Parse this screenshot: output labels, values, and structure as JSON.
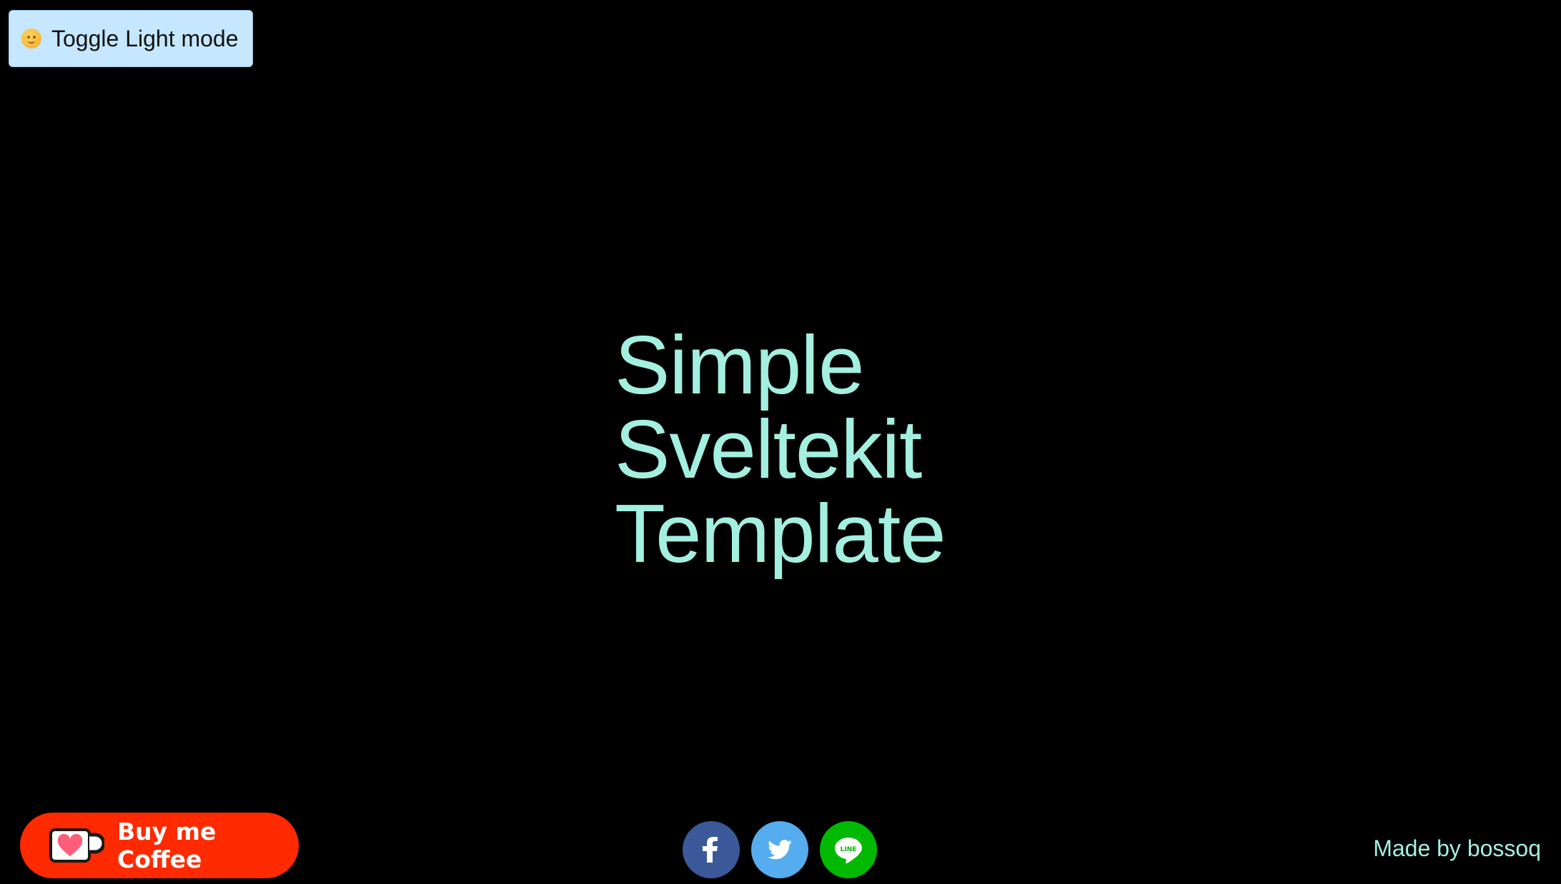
{
  "toggle": {
    "label": "Toggle Light mode",
    "icon": "sun-face-icon"
  },
  "hero": {
    "lines": [
      "Simple",
      "Sveltekit",
      "Template"
    ],
    "color": "#a3efe0"
  },
  "footer": {
    "coffee_button": {
      "label": "Buy me Coffee",
      "icon": "ko-fi-cup-icon",
      "color": "#ff2a00"
    },
    "share": [
      {
        "name": "facebook",
        "icon": "facebook-icon",
        "color": "#3b5998"
      },
      {
        "name": "twitter",
        "icon": "twitter-icon",
        "color": "#55acee"
      },
      {
        "name": "line",
        "icon": "line-icon",
        "color": "#00b900",
        "glyph": "LINE"
      }
    ],
    "credit": "Made by bossoq"
  },
  "colors": {
    "background": "#000000",
    "toggle_background": "#c5e7ff"
  }
}
